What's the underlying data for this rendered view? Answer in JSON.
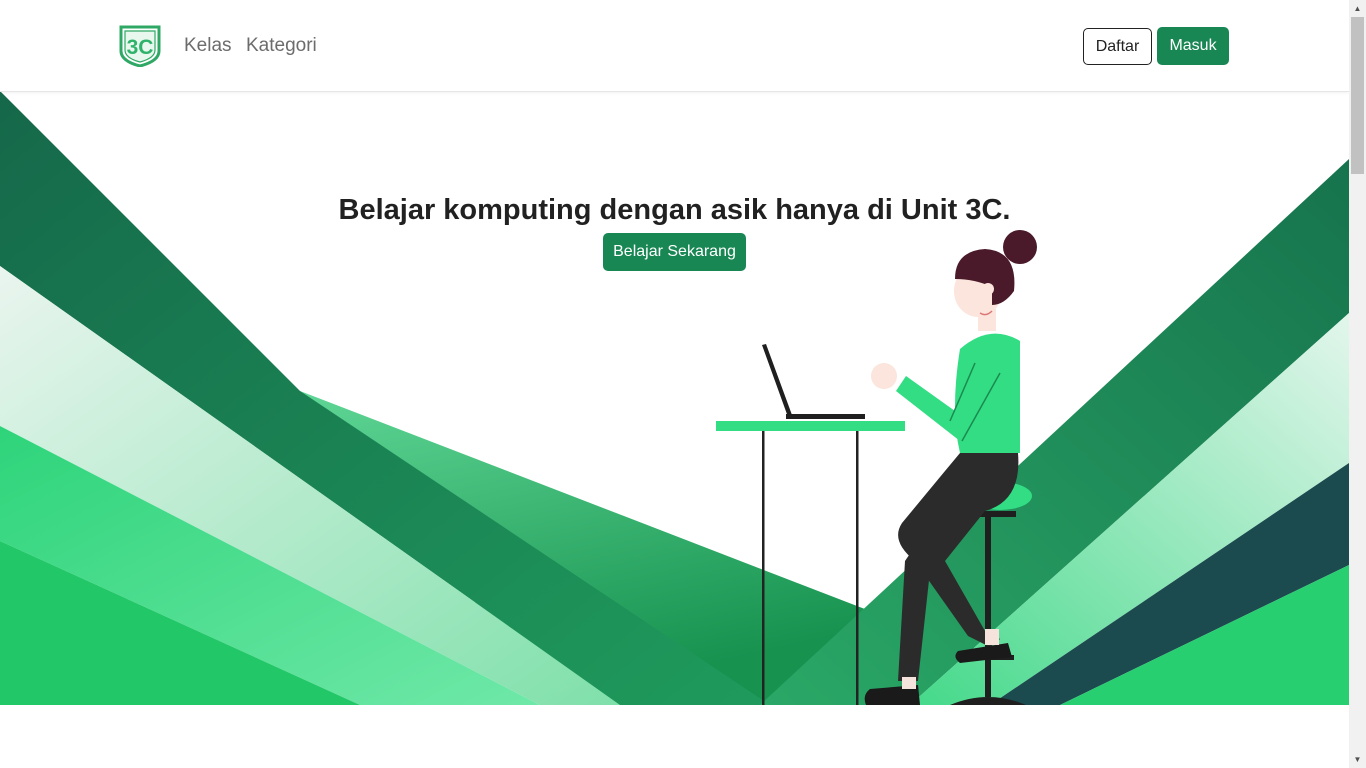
{
  "navbar": {
    "logo_text": "3C",
    "links": [
      "Kelas",
      "Kategori"
    ],
    "register_label": "Daftar",
    "login_label": "Masuk"
  },
  "hero": {
    "title": "Belajar komputing dengan asik hanya di Unit 3C.",
    "cta_label": "Belajar Sekarang"
  },
  "colors": {
    "primary": "#198754",
    "accent_green": "#32dd84",
    "dark_green": "#1a5f45",
    "teal_dark": "#1b4a4f"
  }
}
